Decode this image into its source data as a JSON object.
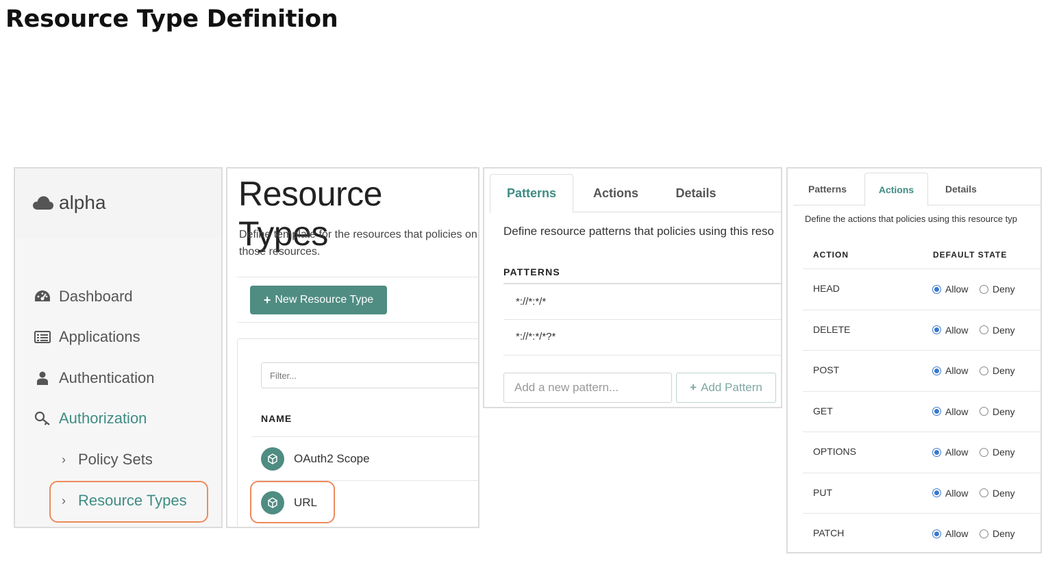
{
  "page": {
    "title": "Resource Type Definition"
  },
  "sidebar": {
    "realm": "alpha",
    "items": [
      {
        "label": "Dashboard",
        "icon": "dashboard-icon"
      },
      {
        "label": "Applications",
        "icon": "applications-icon"
      },
      {
        "label": "Authentication",
        "icon": "user-icon"
      },
      {
        "label": "Authorization",
        "icon": "key-icon"
      }
    ],
    "sub_items": [
      {
        "label": "Policy Sets"
      },
      {
        "label": "Resource Types"
      }
    ]
  },
  "resource_types": {
    "title": "Resource Types",
    "description": "Define template for the resources that policies on those resources.",
    "new_button": "New Resource Type",
    "filter_placeholder": "Filter...",
    "column_name": "NAME",
    "rows": [
      {
        "name": "OAuth2 Scope"
      },
      {
        "name": "URL"
      }
    ]
  },
  "patterns_panel": {
    "tabs": [
      "Patterns",
      "Actions",
      "Details"
    ],
    "active_tab": "Patterns",
    "description": "Define resource patterns that policies using this reso",
    "header": "PATTERNS",
    "patterns": [
      "*://*:*/*",
      "*://*:*/*?*"
    ],
    "new_pattern_placeholder": "Add a new pattern...",
    "add_button": "Add Pattern"
  },
  "actions_panel": {
    "tabs": [
      "Patterns",
      "Actions",
      "Details"
    ],
    "active_tab": "Actions",
    "description": "Define the actions that policies using this resource typ",
    "col_action": "ACTION",
    "col_default": "DEFAULT STATE",
    "allow_label": "Allow",
    "deny_label": "Deny",
    "actions": [
      {
        "name": "HEAD",
        "default": "Allow"
      },
      {
        "name": "DELETE",
        "default": "Allow"
      },
      {
        "name": "POST",
        "default": "Allow"
      },
      {
        "name": "GET",
        "default": "Allow"
      },
      {
        "name": "OPTIONS",
        "default": "Allow"
      },
      {
        "name": "PUT",
        "default": "Allow"
      },
      {
        "name": "PATCH",
        "default": "Allow"
      }
    ]
  },
  "colors": {
    "accent": "#3f8c83",
    "button": "#4f8c82",
    "highlight": "#ee8a5c",
    "radio": "#3a78c9"
  }
}
